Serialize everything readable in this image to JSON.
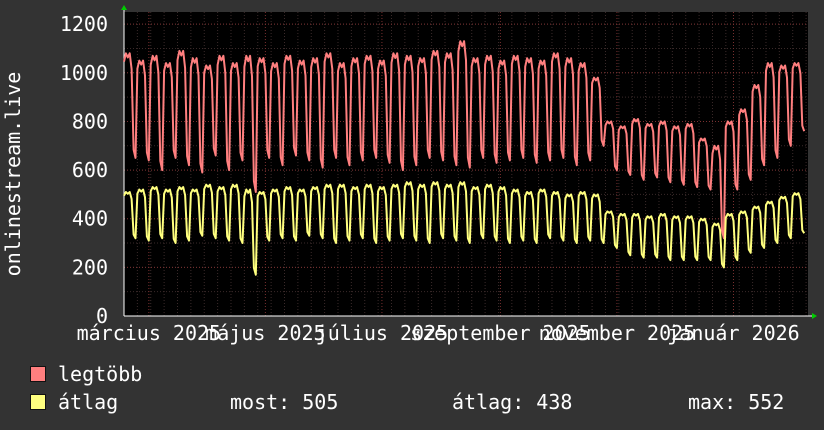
{
  "chart_data": {
    "type": "line",
    "ylabel": "onlinestream.live",
    "ylim": [
      0,
      1250
    ],
    "yticks": [
      0,
      200,
      400,
      600,
      800,
      1000,
      1200
    ],
    "xlim": [
      "2025-02-16",
      "2026-02-09"
    ],
    "xticks": [
      {
        "label": "március 2025",
        "date": "2025-03-01"
      },
      {
        "label": "május 2025",
        "date": "2025-05-01"
      },
      {
        "label": "július 2025",
        "date": "2025-07-01"
      },
      {
        "label": "szeptember 2025",
        "date": "2025-09-01"
      },
      {
        "label": "november 2025",
        "date": "2025-11-01"
      },
      {
        "label": "január 2026",
        "date": "2026-01-01"
      }
    ],
    "grid": true,
    "series": [
      {
        "name": "legtöbb",
        "color": "#ff7f7f",
        "x": [
          "2025-02-16",
          "2025-02-23",
          "2025-03-02",
          "2025-03-09",
          "2025-03-16",
          "2025-03-23",
          "2025-03-30",
          "2025-04-06",
          "2025-04-13",
          "2025-04-20",
          "2025-04-27",
          "2025-05-04",
          "2025-05-11",
          "2025-05-18",
          "2025-05-25",
          "2025-06-01",
          "2025-06-08",
          "2025-06-15",
          "2025-06-22",
          "2025-06-29",
          "2025-07-06",
          "2025-07-13",
          "2025-07-20",
          "2025-07-27",
          "2025-08-03",
          "2025-08-10",
          "2025-08-17",
          "2025-08-24",
          "2025-08-31",
          "2025-09-07",
          "2025-09-14",
          "2025-09-21",
          "2025-09-28",
          "2025-10-05",
          "2025-10-12",
          "2025-10-19",
          "2025-10-26",
          "2025-11-02",
          "2025-11-09",
          "2025-11-16",
          "2025-11-23",
          "2025-11-30",
          "2025-12-07",
          "2025-12-14",
          "2025-12-21",
          "2025-12-28",
          "2026-01-04",
          "2026-01-11",
          "2026-01-18",
          "2026-01-25",
          "2026-02-01"
        ],
        "high": [
          1080,
          1050,
          1070,
          1040,
          1090,
          1060,
          1030,
          1070,
          1040,
          1070,
          1060,
          1040,
          1070,
          1050,
          1060,
          1080,
          1040,
          1060,
          1070,
          1050,
          1080,
          1070,
          1060,
          1090,
          1080,
          1130,
          1060,
          1070,
          1050,
          1070,
          1060,
          1050,
          1080,
          1060,
          1040,
          980,
          800,
          780,
          810,
          790,
          800,
          780,
          790,
          730,
          700,
          800,
          850,
          950,
          1040,
          1030,
          1040
        ],
        "low": [
          650,
          640,
          600,
          650,
          620,
          590,
          660,
          600,
          640,
          510,
          650,
          620,
          660,
          640,
          610,
          650,
          620,
          640,
          650,
          630,
          600,
          620,
          650,
          640,
          620,
          610,
          650,
          630,
          640,
          650,
          630,
          640,
          650,
          620,
          640,
          700,
          600,
          580,
          560,
          570,
          550,
          540,
          530,
          520,
          320,
          520,
          560,
          620,
          650,
          700,
          760
        ]
      },
      {
        "name": "átlag",
        "color": "#ffff7f",
        "x": [
          "2025-02-16",
          "2025-02-23",
          "2025-03-02",
          "2025-03-09",
          "2025-03-16",
          "2025-03-23",
          "2025-03-30",
          "2025-04-06",
          "2025-04-13",
          "2025-04-20",
          "2025-04-27",
          "2025-05-04",
          "2025-05-11",
          "2025-05-18",
          "2025-05-25",
          "2025-06-01",
          "2025-06-08",
          "2025-06-15",
          "2025-06-22",
          "2025-06-29",
          "2025-07-06",
          "2025-07-13",
          "2025-07-20",
          "2025-07-27",
          "2025-08-03",
          "2025-08-10",
          "2025-08-17",
          "2025-08-24",
          "2025-08-31",
          "2025-09-07",
          "2025-09-14",
          "2025-09-21",
          "2025-09-28",
          "2025-10-05",
          "2025-10-12",
          "2025-10-19",
          "2025-10-26",
          "2025-11-02",
          "2025-11-09",
          "2025-11-16",
          "2025-11-23",
          "2025-11-30",
          "2025-12-07",
          "2025-12-14",
          "2025-12-21",
          "2025-12-28",
          "2026-01-04",
          "2026-01-11",
          "2026-01-18",
          "2026-01-25",
          "2026-02-01"
        ],
        "high": [
          510,
          520,
          530,
          520,
          530,
          520,
          540,
          530,
          540,
          520,
          510,
          520,
          530,
          520,
          530,
          540,
          540,
          530,
          540,
          530,
          540,
          550,
          540,
          550,
          540,
          550,
          530,
          540,
          530,
          520,
          510,
          520,
          510,
          500,
          510,
          500,
          430,
          420,
          420,
          410,
          420,
          410,
          410,
          400,
          380,
          420,
          430,
          450,
          470,
          490,
          505
        ],
        "low": [
          320,
          310,
          320,
          300,
          310,
          330,
          320,
          310,
          300,
          170,
          310,
          320,
          310,
          330,
          320,
          300,
          310,
          320,
          300,
          310,
          320,
          310,
          300,
          320,
          310,
          300,
          320,
          310,
          300,
          310,
          300,
          320,
          310,
          300,
          310,
          300,
          280,
          250,
          240,
          240,
          230,
          230,
          230,
          230,
          200,
          230,
          260,
          280,
          300,
          320,
          340
        ]
      }
    ]
  },
  "legend": [
    {
      "label": "legtöbb",
      "color": "#ff7f7f"
    },
    {
      "label": "átlag",
      "color": "#ffff7f"
    }
  ],
  "stats": {
    "current": "most: 505",
    "average": "átlag: 438",
    "max": "max: 552"
  }
}
